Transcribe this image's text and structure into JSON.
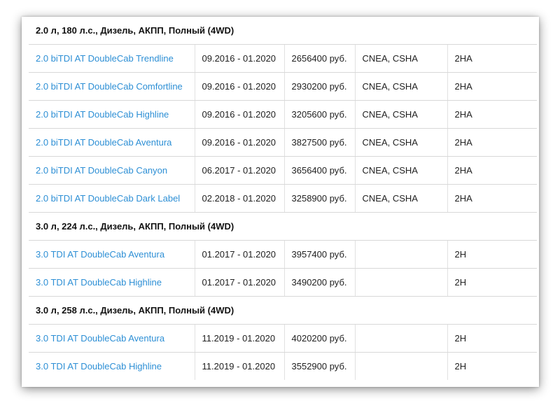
{
  "groups": [
    {
      "title": "2.0 л, 180 л.с., Дизель, АКПП, Полный (4WD)",
      "rows": [
        {
          "model": "2.0 biTDI AT DoubleCab Trendline",
          "period": "09.2016 - 01.2020",
          "price": "2656400 руб.",
          "engine": "CNEA, CSHA",
          "code": "2HA"
        },
        {
          "model": "2.0 biTDI AT DoubleCab Comfortline",
          "period": "09.2016 - 01.2020",
          "price": "2930200 руб.",
          "engine": "CNEA, CSHA",
          "code": "2HA"
        },
        {
          "model": "2.0 biTDI AT DoubleCab Highline",
          "period": "09.2016 - 01.2020",
          "price": "3205600 руб.",
          "engine": "CNEA, CSHA",
          "code": "2HA"
        },
        {
          "model": "2.0 biTDI AT DoubleCab Aventura",
          "period": "09.2016 - 01.2020",
          "price": "3827500 руб.",
          "engine": "CNEA, CSHA",
          "code": "2HA"
        },
        {
          "model": "2.0 biTDI AT DoubleCab Canyon",
          "period": "06.2017 - 01.2020",
          "price": "3656400 руб.",
          "engine": "CNEA, CSHA",
          "code": "2HA"
        },
        {
          "model": "2.0 biTDI AT DoubleCab Dark Label",
          "period": "02.2018 - 01.2020",
          "price": "3258900 руб.",
          "engine": "CNEA, CSHA",
          "code": "2HA"
        }
      ]
    },
    {
      "title": "3.0 л, 224 л.с., Дизель, АКПП, Полный (4WD)",
      "rows": [
        {
          "model": "3.0 TDI AT DoubleCab Aventura",
          "period": "01.2017 - 01.2020",
          "price": "3957400 руб.",
          "engine": "",
          "code": "2H"
        },
        {
          "model": "3.0 TDI AT DoubleCab Highline",
          "period": "01.2017 - 01.2020",
          "price": "3490200 руб.",
          "engine": "",
          "code": "2H"
        }
      ]
    },
    {
      "title": "3.0 л, 258 л.с., Дизель, АКПП, Полный (4WD)",
      "rows": [
        {
          "model": "3.0 TDI AT DoubleCab Aventura",
          "period": "11.2019 - 01.2020",
          "price": "4020200 руб.",
          "engine": "",
          "code": "2H"
        },
        {
          "model": "3.0 TDI AT DoubleCab Highline",
          "period": "11.2019 - 01.2020",
          "price": "3552900 руб.",
          "engine": "",
          "code": "2H"
        }
      ]
    }
  ]
}
